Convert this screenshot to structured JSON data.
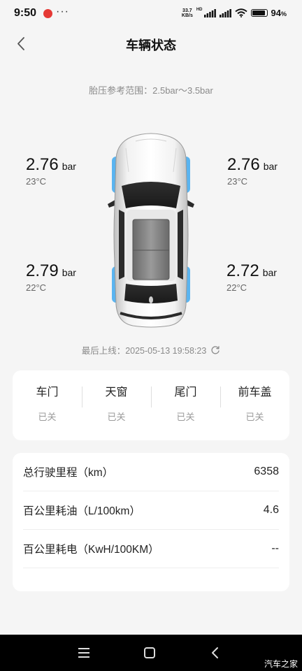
{
  "status_bar": {
    "time": "9:50",
    "more": "···",
    "net_speed_value": "33.7",
    "net_speed_unit": "KB/s",
    "hd": "HD",
    "battery_level": 0.94,
    "battery_percent": "94",
    "battery_suffix": "%"
  },
  "header": {
    "title": "车辆状态"
  },
  "tire_pressure": {
    "range_text": "胎压参考范围：2.5bar～3.5bar",
    "unit": "bar",
    "front_left": {
      "value": "2.76",
      "temp": "23°C"
    },
    "front_right": {
      "value": "2.76",
      "temp": "23°C"
    },
    "rear_left": {
      "value": "2.79",
      "temp": "22°C"
    },
    "rear_right": {
      "value": "2.72",
      "temp": "22°C"
    }
  },
  "last_online": {
    "text": "最后上线：2025-05-13 19:58:23"
  },
  "status_items": [
    {
      "label": "车门",
      "value": "已关"
    },
    {
      "label": "天窗",
      "value": "已关"
    },
    {
      "label": "尾门",
      "value": "已关"
    },
    {
      "label": "前车盖",
      "value": "已关"
    }
  ],
  "stats": [
    {
      "label": "总行驶里程（km）",
      "value": "6358"
    },
    {
      "label": "百公里耗油（L/100km）",
      "value": "4.6"
    },
    {
      "label": "百公里耗电（KwH/100KM）",
      "value": "--"
    }
  ],
  "watermark": "汽车之家",
  "colors": {
    "tire_highlight": "#5ab4f0",
    "background": "#f5f5f5",
    "card": "#ffffff",
    "nav_bar": "#000000"
  }
}
